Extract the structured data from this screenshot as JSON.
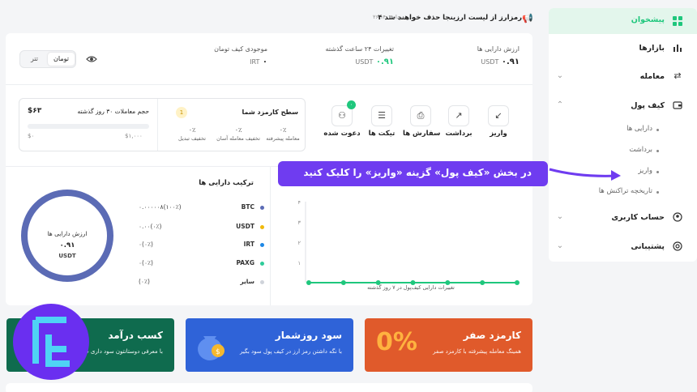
{
  "notice": {
    "text": "۴ رمزارز از لیست ارزینجا حذف خواهند شد",
    "date": "۲۶ مرداد ۱۴۰۴"
  },
  "sidebar": {
    "items": [
      {
        "label": "پیشخوان",
        "icon": "dashboard-icon",
        "active": true
      },
      {
        "label": "بازارها",
        "icon": "markets-chart-icon"
      },
      {
        "label": "معامله",
        "icon": "exchange-arrows-icon"
      },
      {
        "label": "کیف پول",
        "icon": "wallet-icon"
      },
      {
        "label": "حساب کاربری",
        "icon": "user-account-icon"
      },
      {
        "label": "پشتیبانی",
        "icon": "support-icon"
      }
    ],
    "wallet_sub": [
      "دارایی ها",
      "برداشت",
      "واریز",
      "تاریخچه تراکنش ها"
    ]
  },
  "stats": {
    "assets_title": "ارزش دارایی ها",
    "assets_value": "۰.۹۱",
    "assets_unit": "USDT",
    "change_title": "تغییرات ۲۴ ساعت گذشته",
    "change_value": "۰.۹۱",
    "change_unit": "USDT",
    "toman_title": "موجودی کیف تومان",
    "toman_value": "۰",
    "toman_unit": "IRT"
  },
  "toggle": {
    "on": "تومان",
    "off": "تتر"
  },
  "quick_actions": [
    {
      "label": "واریز",
      "icon": "deposit-icon"
    },
    {
      "label": "برداشت",
      "icon": "withdraw-icon"
    },
    {
      "label": "سفارش ها",
      "icon": "orders-icon"
    },
    {
      "label": "تیکت ها",
      "icon": "ticket-icon"
    },
    {
      "label": "دعوت شده",
      "icon": "invited-users-icon",
      "badge": "۰"
    }
  ],
  "fees": {
    "level_title": "سطح کارمزد شما",
    "level_badge": "1",
    "cols": [
      {
        "pct": "۰٪",
        "label": "معامله پیشرفته"
      },
      {
        "pct": "۰٪",
        "label": "تخفیف معامله آسان"
      },
      {
        "pct": "۰٪",
        "label": "تخفیف تبدیل"
      }
    ],
    "volume_title": "حجم معاملات ۳۰ روز گذشته",
    "volume_value": "$۶۳",
    "bar_min": "$۰",
    "bar_max": "$۱,۰۰۰"
  },
  "composition": {
    "title": "ترکیب دارایی ها",
    "donut_title": "ارزش دارایی ها",
    "donut_value": "۰.۹۱",
    "donut_unit": "USDT",
    "legend": [
      {
        "name": "BTC",
        "value": "۰.۰۰۰۰۰۸(۱۰۰٪)",
        "color": "#5b6bb5"
      },
      {
        "name": "USDT",
        "value": "۰.۰۰(۰٪)",
        "color": "#f0b90b"
      },
      {
        "name": "IRT",
        "value": "۰(۰٪)",
        "color": "#1e88e5"
      },
      {
        "name": "PAXG",
        "value": "۰(۰٪)",
        "color": "#2ecc9a"
      },
      {
        "name": "سایر",
        "value": "(۰٪)",
        "color": "#cfd3da"
      }
    ]
  },
  "chart_data": {
    "type": "line",
    "title": "",
    "xlabel": "تغییرات دارایی کیف‌پول در ۷ روز گذشته",
    "ylabel": "",
    "yticks": [
      "۱",
      "۲",
      "۳",
      "۴"
    ],
    "ylim": [
      0,
      4
    ],
    "series": [
      {
        "values": [
          0,
          0,
          0,
          0,
          0,
          0,
          0
        ],
        "color": "#1fc77d"
      }
    ]
  },
  "banners": [
    {
      "title": "کارمزد صفر",
      "sub": "همینگ معامله پیشرفته با کارمزد صفر",
      "color": "#e05a2b",
      "icon": "zero-percent-icon"
    },
    {
      "title": "سود روزشمار",
      "sub": "با نگه داشتن رمز ارز در کیف پول سود بگیر",
      "color": "#2f63d8",
      "icon": "money-bag-icon"
    },
    {
      "title": "کسب درآمد",
      "sub": "با معرفی دوستانتون سود داری ب",
      "color": "#0f6b4e",
      "icon": "earn-icon"
    }
  ],
  "callout": {
    "text": "در بخش «کیف پول» گزینه «واریز» را کلیک کنید"
  },
  "colors": {
    "accent": "#1fc77d",
    "callout": "#6f3cf0",
    "brand_logo": "#6a2ff0"
  }
}
